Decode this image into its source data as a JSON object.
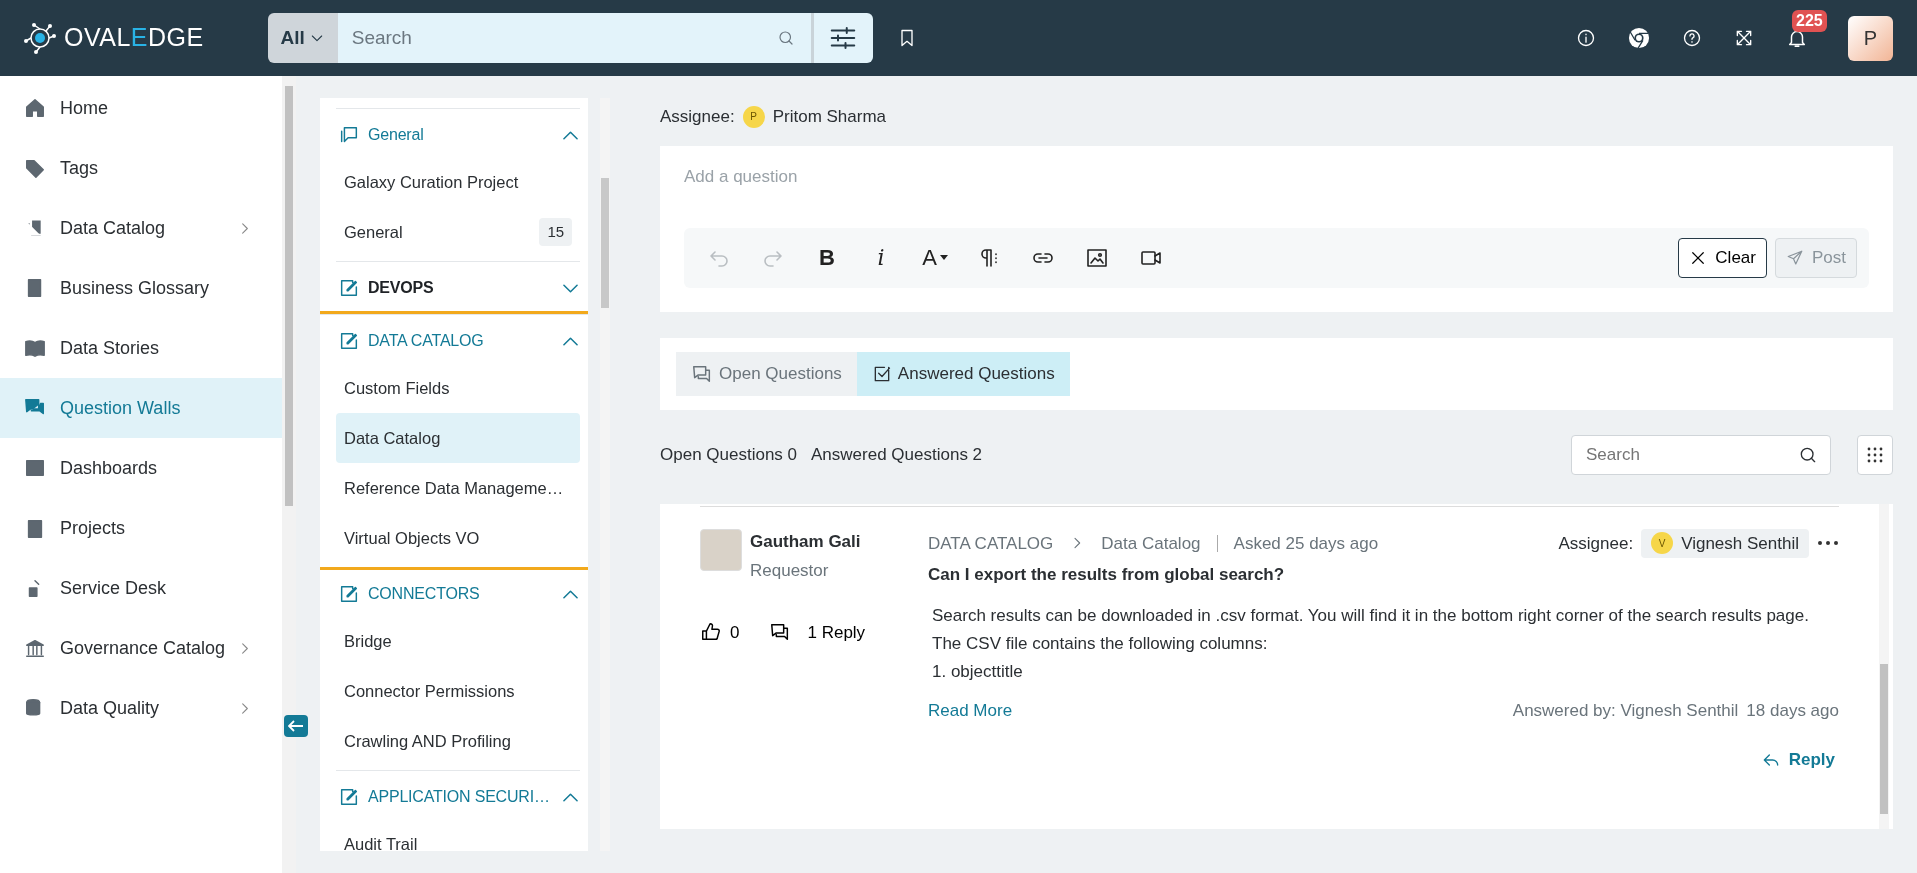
{
  "header": {
    "logo": {
      "start": "OVAL",
      "accent": "E",
      "end": "DGE"
    },
    "search_scope": "All",
    "search_placeholder": "Search",
    "notification_count": "225",
    "avatar_initial": "P"
  },
  "nav": [
    {
      "label": "Home",
      "selected": false,
      "has_submenu": false
    },
    {
      "label": "Tags",
      "selected": false,
      "has_submenu": false
    },
    {
      "label": "Data Catalog",
      "selected": false,
      "has_submenu": true
    },
    {
      "label": "Business Glossary",
      "selected": false,
      "has_submenu": false
    },
    {
      "label": "Data Stories",
      "selected": false,
      "has_submenu": false
    },
    {
      "label": "Question Walls",
      "selected": true,
      "has_submenu": false
    },
    {
      "label": "Dashboards",
      "selected": false,
      "has_submenu": false
    },
    {
      "label": "Projects",
      "selected": false,
      "has_submenu": false
    },
    {
      "label": "Service Desk",
      "selected": false,
      "has_submenu": false
    },
    {
      "label": "Governance Catalog",
      "selected": false,
      "has_submenu": true
    },
    {
      "label": "Data Quality",
      "selected": false,
      "has_submenu": true
    }
  ],
  "topics": [
    {
      "kind": "chat",
      "title": "General",
      "expanded": true,
      "highlighted": false,
      "items": [
        {
          "label": "Galaxy Curation Project",
          "selected": false
        },
        {
          "label": "General",
          "selected": false,
          "count": "15"
        }
      ]
    },
    {
      "kind": "edit",
      "title": "DEVOPS",
      "expanded": false,
      "highlighted": false
    },
    {
      "kind": "edit",
      "title": "DATA CATALOG",
      "expanded": true,
      "highlighted": true,
      "items": [
        {
          "label": "Custom Fields",
          "selected": false
        },
        {
          "label": "Data Catalog",
          "selected": true
        },
        {
          "label": "Reference Data Manageme…",
          "selected": false
        },
        {
          "label": "Virtual Objects VO",
          "selected": false
        }
      ]
    },
    {
      "kind": "edit",
      "title": "CONNECTORS",
      "expanded": true,
      "highlighted": false,
      "items": [
        {
          "label": "Bridge",
          "selected": false
        },
        {
          "label": "Connector Permissions",
          "selected": false
        },
        {
          "label": "Crawling AND Profiling",
          "selected": false
        }
      ]
    },
    {
      "kind": "edit",
      "title": "APPLICATION SECURI…",
      "expanded": true,
      "highlighted": false,
      "items": [
        {
          "label": "Audit Trail",
          "selected": false
        }
      ]
    }
  ],
  "composer": {
    "assignee_label": "Assignee:",
    "assignee_initial": "P",
    "assignee_name": "Pritom Sharma",
    "placeholder": "Add a question",
    "toolbar": [
      {
        "kind": "undo",
        "disabled": true
      },
      {
        "kind": "redo",
        "disabled": true
      },
      {
        "kind": "bold",
        "label": "B",
        "disabled": false
      },
      {
        "kind": "italic",
        "label": "i",
        "disabled": false
      },
      {
        "kind": "font",
        "label": "A",
        "disabled": false
      },
      {
        "kind": "paragraph",
        "disabled": false
      },
      {
        "kind": "link",
        "disabled": false
      },
      {
        "kind": "image",
        "disabled": false
      },
      {
        "kind": "video",
        "disabled": false
      }
    ],
    "clear_label": "Clear",
    "post_label": "Post",
    "post_disabled": true
  },
  "tabs": [
    {
      "kind": "open",
      "label": "Open Questions",
      "selected": false
    },
    {
      "kind": "answered",
      "label": "Answered Questions",
      "selected": true
    }
  ],
  "summary": [
    "Open Questions 0",
    "Answered Questions 2"
  ],
  "list_search_placeholder": "Search",
  "questions": [
    {
      "author": "Gautham Gali",
      "role": "Requestor",
      "likes": "0",
      "replies": "1 Reply",
      "breadcrumb": [
        "DATA CATALOG",
        "Data Catalog"
      ],
      "asked": "Asked 25 days ago",
      "title": "Can I export the results from global search?",
      "assignee_label": "Assignee:",
      "assignee_initial": "V",
      "assignee_name": "Vignesh Senthil",
      "answer_lines": [
        "Search results can be downloaded in .csv format. You will find it in the bottom right corner of the search results page.",
        "The CSV file contains the following columns:",
        "1. objecttitle"
      ],
      "read_more": "Read More",
      "answered_by": "Answered by: Vignesh Senthil",
      "answered_ago": "18 days ago",
      "reply_label": "Reply"
    }
  ]
}
